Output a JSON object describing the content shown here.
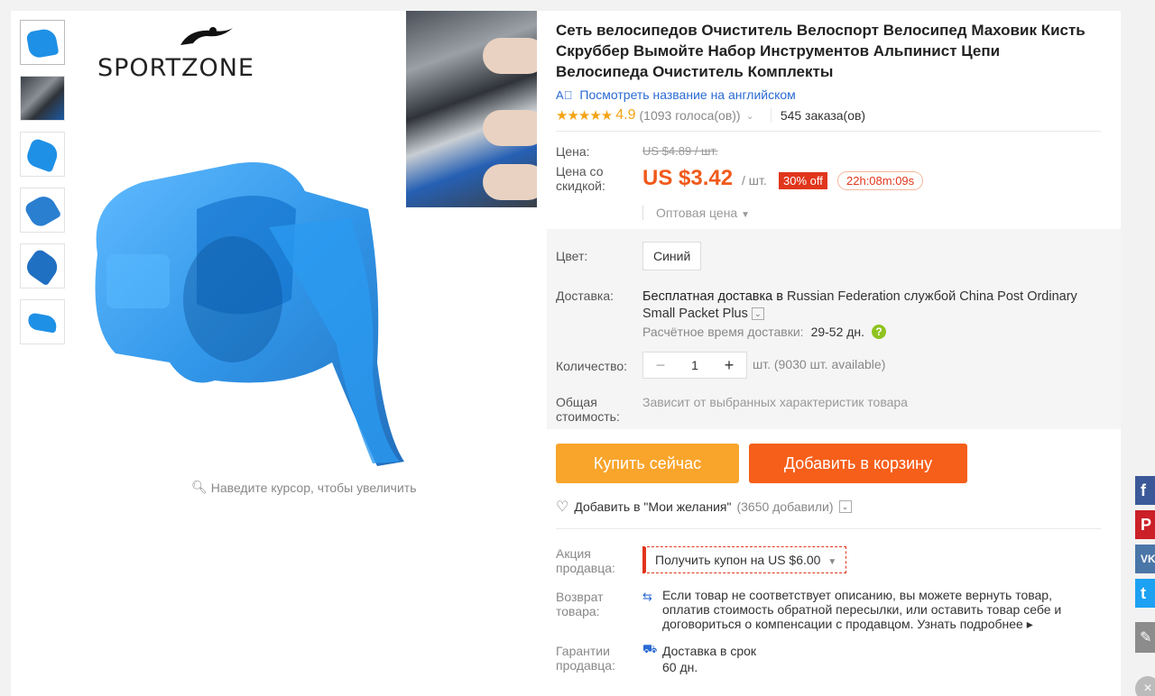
{
  "logo": {
    "text": "SPORTZONE"
  },
  "gallery": {
    "zoom_hint": "Наведите курсор, чтобы увеличить"
  },
  "product": {
    "title": "Сеть велосипедов Очиститель Велоспорт Велосипед Маховик Кисть Скруббер Вымойте Набор Инструментов Альпинист Цепи Велосипеда Очиститель Комплекты",
    "translate_link": "Посмотреть название на английском",
    "rating": {
      "stars": "★★★★★",
      "value": "4.9",
      "votes": "(1093 голоса(ов))",
      "orders": "545 заказа(ов)"
    }
  },
  "price": {
    "label_price": "Цена:",
    "old": "US $4.89 / шт.",
    "label_discount_1": "Цена со",
    "label_discount_2": "скидкой:",
    "new": "US $3.42",
    "per_unit": "/ шт.",
    "discount_badge": "30% off",
    "timer": "22h:08m:09s",
    "wholesale": "Оптовая цена"
  },
  "specs": {
    "color_label": "Цвет:",
    "color_value": "Синий",
    "shipping_label": "Доставка:",
    "shipping_strong": "Бесплатная доставка в",
    "shipping_rest": " Russian Federation службой China Post Ordinary Small Packet Plus",
    "ship_time_label": "Расчётное время доставки:",
    "ship_time_value": "29-52 дн.",
    "qty_label": "Количество:",
    "qty_value": "1",
    "qty_minus": "−",
    "qty_plus": "+",
    "qty_avail": "шт. (9030 шт. available)",
    "total_label_1": "Общая",
    "total_label_2": "стоимость:",
    "total_value": "Зависит от выбранных характеристик товара"
  },
  "actions": {
    "buy_now": "Купить сейчас",
    "add_to_cart": "Добавить в корзину",
    "wishlist": "Добавить в \"Мои желания\"",
    "wishlist_count": "(3650 добавили)"
  },
  "seller": {
    "promo_label_1": "Акция",
    "promo_label_2": "продавца:",
    "coupon": "Получить купон на US $6.00",
    "return_label_1": "Возврат",
    "return_label_2": "товара:",
    "return_text": "Если товар не соответствует описанию, вы можете вернуть товар, оплатив стоимость обратной пересылки, или оставить товар себе и договориться о компенсации с продавцом.",
    "return_more": "Узнать подробнее ▸",
    "guarantee_label_1": "Гарантии",
    "guarantee_label_2": "продавца:",
    "guarantee_text": "Доставка в срок",
    "guarantee_days": "60 дн."
  },
  "social": {
    "facebook": "f",
    "pinterest": "P",
    "vk": "VK",
    "twitter": "t"
  },
  "colors": {
    "accent_orange": "#f65f1a",
    "buy_yellow": "#f9a52c",
    "price_red": "#f05a1b",
    "link_blue": "#2a6ad3",
    "star": "#f3a316"
  }
}
